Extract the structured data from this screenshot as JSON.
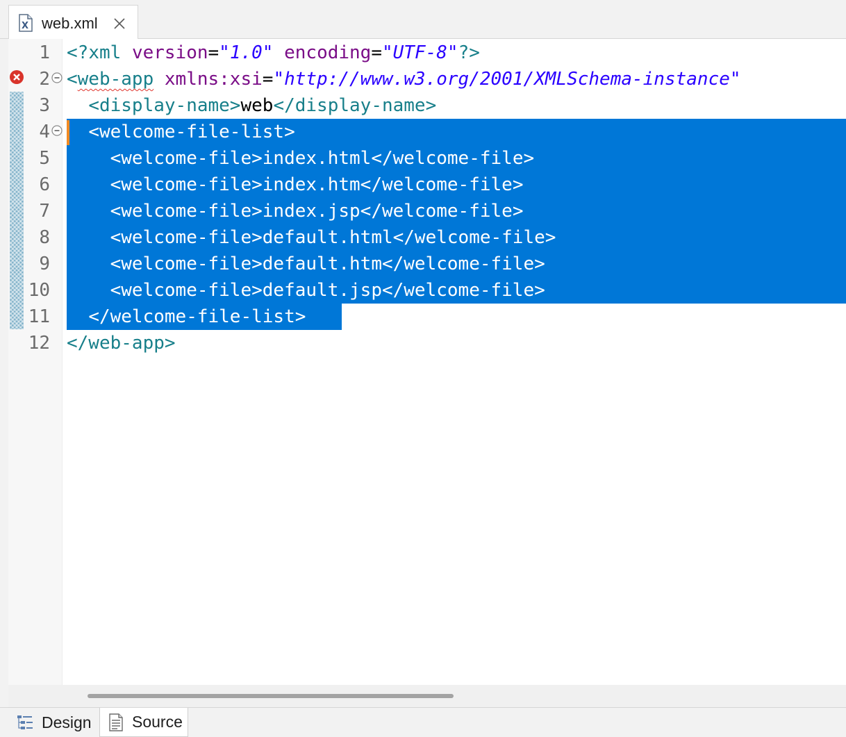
{
  "editor_tab": {
    "title": "web.xml",
    "icon": "xml-file-icon"
  },
  "line_numbers": [
    "1",
    "2",
    "3",
    "4",
    "5",
    "6",
    "7",
    "8",
    "9",
    "10",
    "11",
    "12"
  ],
  "code": {
    "l1": {
      "open": "<?",
      "pi": "xml",
      "sp1": " ",
      "attr1": "version",
      "eq1": "=",
      "val1": "\"1.0\"",
      "sp2": " ",
      "attr2": "encoding",
      "eq2": "=",
      "val2": "\"UTF-8\"",
      "close": "?>"
    },
    "l2": {
      "lt": "<",
      "tag": "web-app",
      "sp": " ",
      "attr": "xmlns:xsi",
      "eq": "=",
      "val": "\"http://www.w3.org/2001/XMLSchema-instance\""
    },
    "l3": {
      "indent": "  ",
      "open": "<display-name>",
      "text": "web",
      "close": "</display-name>"
    },
    "l4": {
      "indent": "  ",
      "tag": "<welcome-file-list>"
    },
    "l5": {
      "indent": "    ",
      "open": "<welcome-file>",
      "text": "index.html",
      "close": "</welcome-file>"
    },
    "l6": {
      "indent": "    ",
      "open": "<welcome-file>",
      "text": "index.htm",
      "close": "</welcome-file>"
    },
    "l7": {
      "indent": "    ",
      "open": "<welcome-file>",
      "text": "index.jsp",
      "close": "</welcome-file>"
    },
    "l8": {
      "indent": "    ",
      "open": "<welcome-file>",
      "text": "default.html",
      "close": "</welcome-file>"
    },
    "l9": {
      "indent": "    ",
      "open": "<welcome-file>",
      "text": "default.htm",
      "close": "</welcome-file>"
    },
    "l10": {
      "indent": "    ",
      "open": "<welcome-file>",
      "text": "default.jsp",
      "close": "</welcome-file>"
    },
    "l11": {
      "indent": "  ",
      "tag": "</welcome-file-list>"
    },
    "l12": {
      "tag": "</web-app>"
    }
  },
  "colors": {
    "tag": "#177f8a",
    "attribute": "#7a0d87",
    "value": "#2a00ff",
    "selection": "#0077d7",
    "error": "#d9342b"
  },
  "bottom_tabs": [
    {
      "label": "Design",
      "icon": "design-tree-icon"
    },
    {
      "label": "Source",
      "icon": "source-page-icon"
    }
  ]
}
